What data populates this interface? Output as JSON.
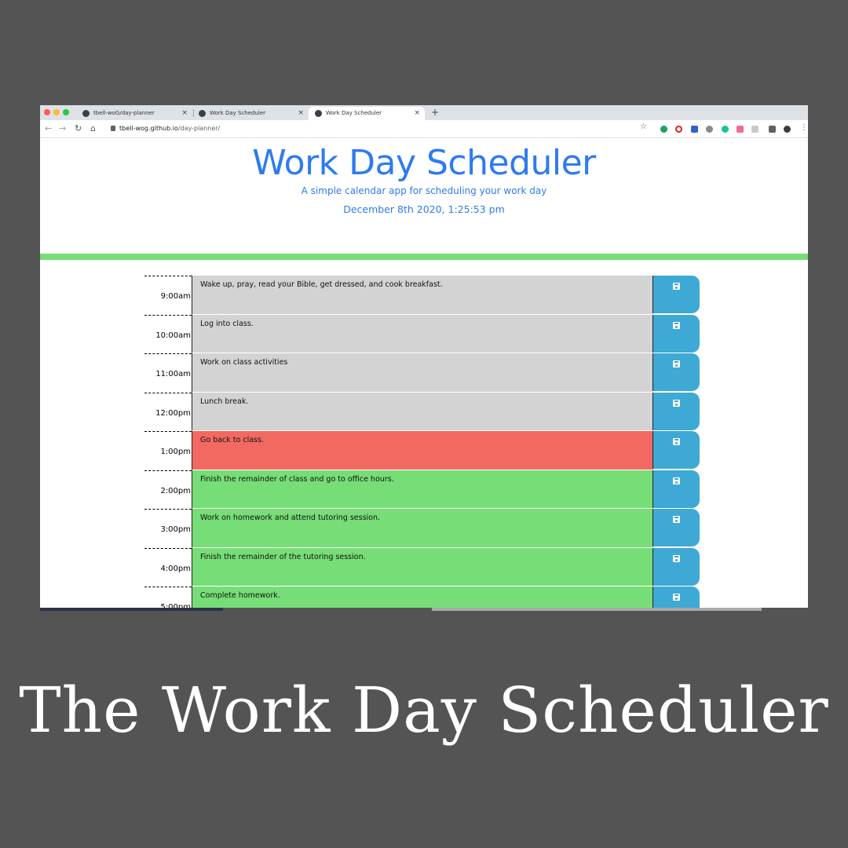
{
  "browser": {
    "tabs": [
      {
        "label": "tbell-woG/day-planner"
      },
      {
        "label": "Work Day Scheduler"
      },
      {
        "label": "Work Day Scheduler"
      }
    ],
    "url_host": "tbell-wog.github.io",
    "url_path": "/day-planner/"
  },
  "header": {
    "title": "Work Day Scheduler",
    "subtitle": "A simple calendar app for scheduling your work day",
    "date": "December 8th 2020, 1:25:53 pm"
  },
  "schedule": [
    {
      "hour": "9:00am",
      "task": "Wake up, pray, read your Bible,  get dressed, and cook breakfast.",
      "state": "past"
    },
    {
      "hour": "10:00am",
      "task": "Log into class.",
      "state": "past"
    },
    {
      "hour": "11:00am",
      "task": "Work on class activities",
      "state": "past"
    },
    {
      "hour": "12:00pm",
      "task": "Lunch break.",
      "state": "past"
    },
    {
      "hour": "1:00pm",
      "task": "Go back to class.",
      "state": "present"
    },
    {
      "hour": "2:00pm",
      "task": "Finish the remainder of class and go to office hours.",
      "state": "future"
    },
    {
      "hour": "3:00pm",
      "task": "Work on homework and attend tutoring session.",
      "state": "future"
    },
    {
      "hour": "4:00pm",
      "task": "Finish the remainder of the tutoring session.",
      "state": "future"
    },
    {
      "hour": "5:00pm",
      "task": "Complete homework.",
      "state": "future"
    }
  ],
  "colors": {
    "past": "#d3d3d3",
    "present": "#f26962",
    "future": "#77dd77",
    "accent": "#2e7bef",
    "save": "#3fa9d6"
  },
  "caption": "The Work Day Scheduler"
}
